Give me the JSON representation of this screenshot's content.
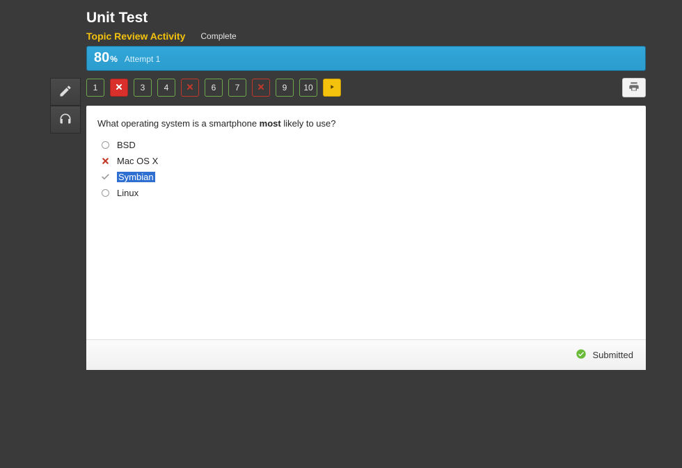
{
  "header": {
    "title": "Unit Test",
    "topic": "Topic Review Activity",
    "status": "Complete"
  },
  "score": {
    "value": "80",
    "pct_symbol": "%",
    "attempt": "Attempt 1"
  },
  "nav": {
    "items": [
      {
        "label": "1",
        "state": "correct"
      },
      {
        "label": "",
        "state": "wrong-filled"
      },
      {
        "label": "3",
        "state": "correct"
      },
      {
        "label": "4",
        "state": "correct"
      },
      {
        "label": "",
        "state": "wrong-outline"
      },
      {
        "label": "6",
        "state": "correct"
      },
      {
        "label": "7",
        "state": "correct"
      },
      {
        "label": "",
        "state": "wrong-outline"
      },
      {
        "label": "9",
        "state": "correct"
      },
      {
        "label": "10",
        "state": "correct"
      }
    ]
  },
  "question": {
    "prefix": "What operating system is a smartphone ",
    "emph": "most",
    "suffix": " likely to use?"
  },
  "options": [
    {
      "label": "BSD",
      "status": "none"
    },
    {
      "label": "Mac OS X",
      "status": "wrong"
    },
    {
      "label": "Symbian",
      "status": "correct",
      "highlight": true
    },
    {
      "label": "Linux",
      "status": "none"
    }
  ],
  "footer": {
    "submitted": "Submitted"
  }
}
